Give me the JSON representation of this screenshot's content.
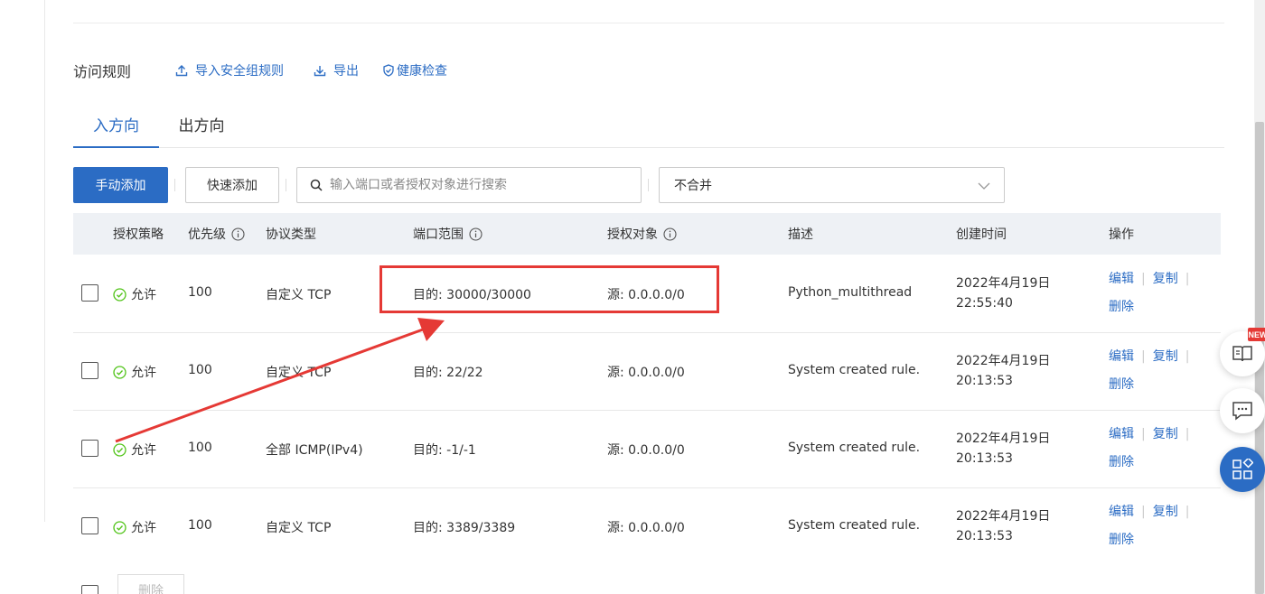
{
  "section": {
    "title": "访问规则",
    "links": [
      {
        "label": "导入安全组规则",
        "icon": "upload-icon"
      },
      {
        "label": "导出",
        "icon": "download-icon"
      },
      {
        "label": "健康检查",
        "icon": "shield-check-icon"
      }
    ]
  },
  "tabs": [
    {
      "label": "入方向",
      "active": true
    },
    {
      "label": "出方向",
      "active": false
    }
  ],
  "actions": {
    "manual_add": "手动添加",
    "quick_add": "快速添加",
    "search_placeholder": "输入端口或者授权对象进行搜索",
    "merge_select": "不合并"
  },
  "table": {
    "headers": {
      "policy": "授权策略",
      "priority": "优先级",
      "protocol": "协议类型",
      "port_range": "端口范围",
      "auth_object": "授权对象",
      "description": "描述",
      "created": "创建时间",
      "operations": "操作"
    },
    "rows": [
      {
        "policy": "允许",
        "priority": "100",
        "protocol": "自定义 TCP",
        "port": "目的: 30000/30000",
        "source": "源: 0.0.0.0/0",
        "description": "Python_multithread",
        "date": "2022年4月19日",
        "time": "22:55:40"
      },
      {
        "policy": "允许",
        "priority": "100",
        "protocol": "自定义 TCP",
        "port": "目的: 22/22",
        "source": "源: 0.0.0.0/0",
        "description": "System created rule.",
        "date": "2022年4月19日",
        "time": "20:13:53"
      },
      {
        "policy": "允许",
        "priority": "100",
        "protocol": "全部 ICMP(IPv4)",
        "port": "目的: -1/-1",
        "source": "源: 0.0.0.0/0",
        "description": "System created rule.",
        "date": "2022年4月19日",
        "time": "20:13:53"
      },
      {
        "policy": "允许",
        "priority": "100",
        "protocol": "自定义 TCP",
        "port": "目的: 3389/3389",
        "source": "源: 0.0.0.0/0",
        "description": "System created rule.",
        "date": "2022年4月19日",
        "time": "20:13:53"
      }
    ],
    "row_ops": {
      "edit": "编辑",
      "copy": "复制",
      "delete": "删除"
    }
  },
  "bottom": {
    "delete_label": "删除"
  },
  "floating": {
    "new_badge": "NEW"
  },
  "colors": {
    "accent": "#2b6cc4",
    "allow_green": "#52c41a",
    "annotation_red": "#e53935"
  }
}
